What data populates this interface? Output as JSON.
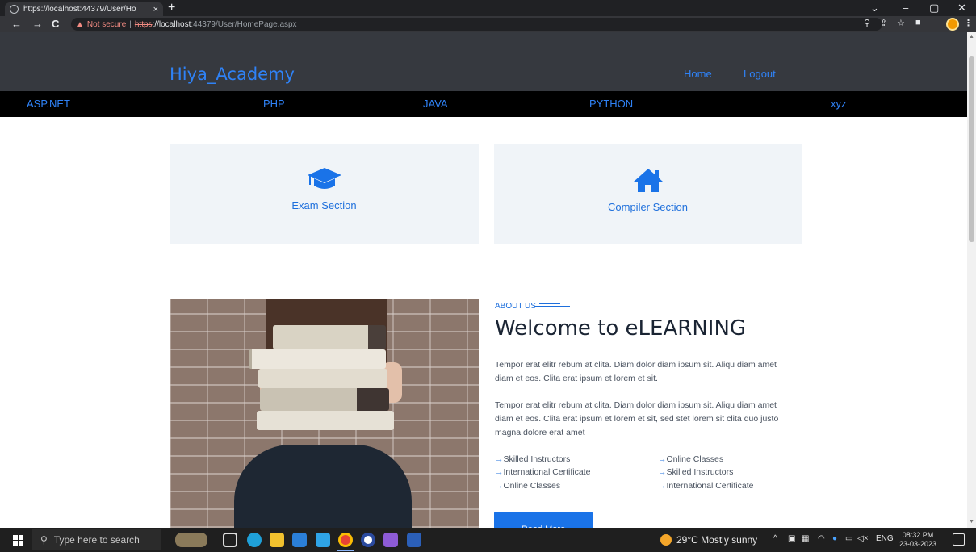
{
  "browser": {
    "tab_title": "https://localhost:44379/User/Ho",
    "tab_close": "×",
    "new_tab": "+",
    "window_controls": {
      "minimize": "–",
      "maximize": "▢",
      "close": "✕",
      "tab_search": "⌄"
    },
    "nav": {
      "back": "←",
      "forward": "→",
      "reload": "C"
    },
    "security_label": "Not secure",
    "separator": "|",
    "url_scheme": "https",
    "url_host": "://localhost",
    "url_path": ":44379/User/HomePage.aspx",
    "omnibox_icons": {
      "zoom": "⚲",
      "share": "⇪",
      "star": "☆",
      "sidepanel": "■"
    }
  },
  "site": {
    "brand": "Hiya_Academy",
    "top_links": [
      "Home",
      "Logout"
    ],
    "subnav": [
      "ASP.NET",
      "PHP",
      "JAVA",
      "PYTHON",
      "xyz"
    ],
    "cards": [
      {
        "label": "Exam Section",
        "icon": "graduation-cap-icon"
      },
      {
        "label": "Compiler Section",
        "icon": "home-icon"
      }
    ],
    "about": {
      "kicker": "ABOUT US",
      "title": "Welcome to eLEARNING",
      "para1": "Tempor erat elitr rebum at clita. Diam dolor diam ipsum sit. Aliqu diam amet diam et eos. Clita erat ipsum et lorem et sit.",
      "para2": "Tempor erat elitr rebum at clita. Diam dolor diam ipsum sit. Aliqu diam amet diam et eos. Clita erat ipsum et lorem et sit, sed stet lorem sit clita duo justo magna dolore erat amet",
      "arrow": "→",
      "features_left": [
        "Skilled Instructors",
        "International Certificate",
        "Online Classes"
      ],
      "features_right": [
        "Online Classes",
        "Skilled Instructors",
        "International Certificate"
      ],
      "button": "Read More"
    },
    "accent_color": "#1a73e8"
  },
  "taskbar": {
    "search_placeholder": "Type here to search",
    "weather": "29°C  Mostly sunny",
    "tray_chevron": "^",
    "language": "ENG",
    "time": "08:32 PM",
    "date": "23-03-2023"
  }
}
